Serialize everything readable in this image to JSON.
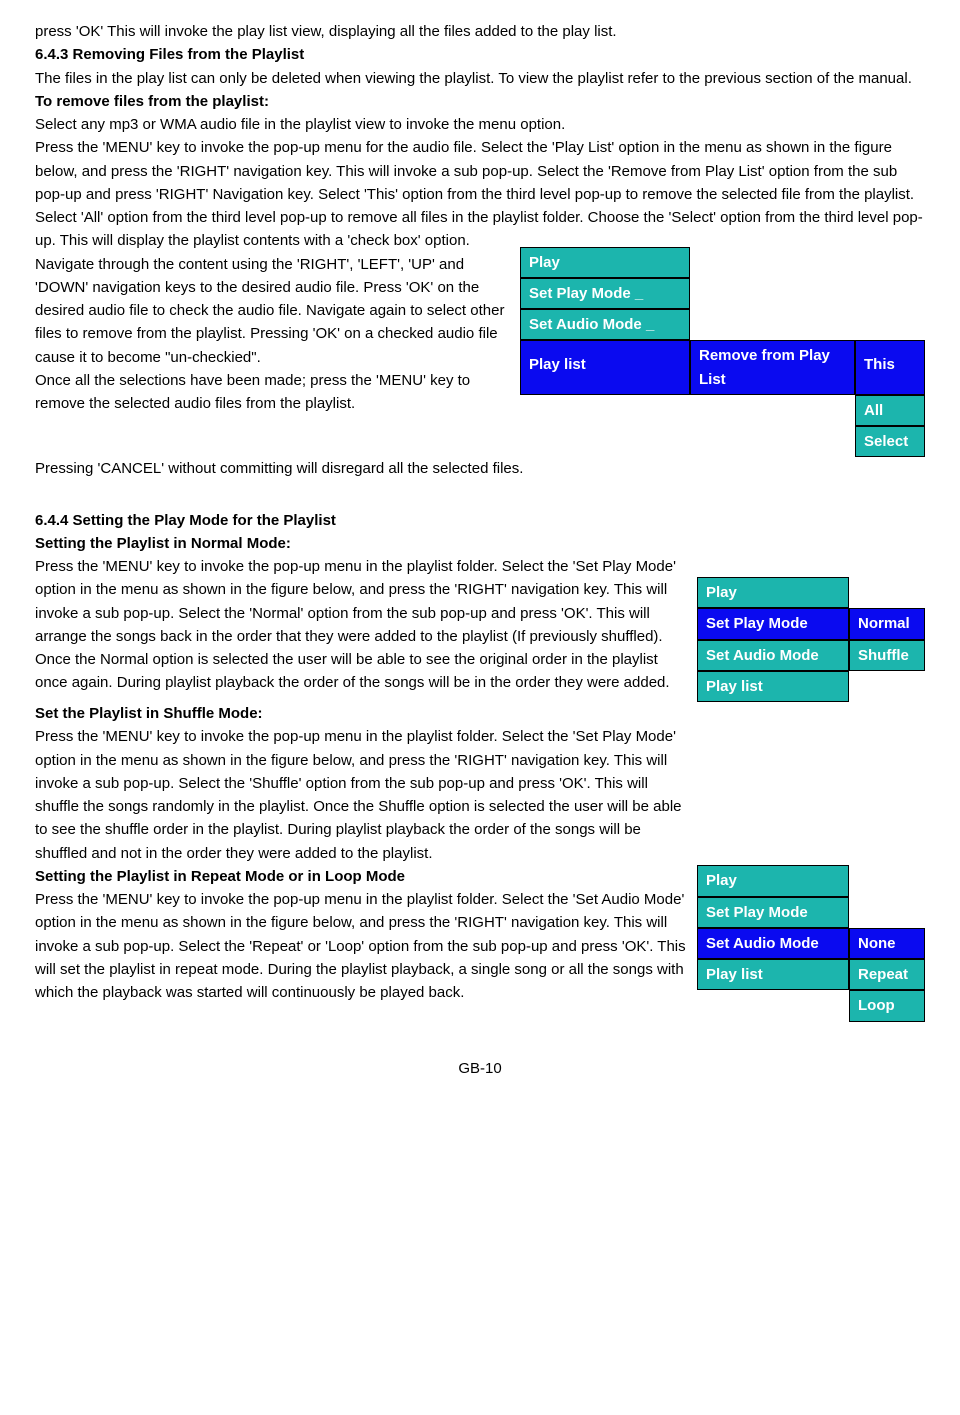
{
  "intro": "press 'OK' This will invoke the play list view, displaying all the files added to the play list.",
  "s643": {
    "heading": "6.4.3 Removing Files from the Playlist",
    "p1": "The files in the play list can only be deleted when viewing the playlist. To view the playlist refer to the previous section of the manual.",
    "sub1": "To remove files from the playlist:",
    "p2": "Select any mp3 or WMA audio file in the playlist view to invoke the  menu option.",
    "p3": "Press the 'MENU' key to  invoke the pop-up menu for the audio file. Select the 'Play List' option  in the menu as shown in the figure below, and press the 'RIGHT' navigation key. This will invoke a sub pop-up. Select the 'Remove from Play List' option from the sub pop-up and press 'RIGHT' Navigation key. Select 'This' option from the third level pop-up to remove the selected file from the playlist. Select 'All' option from the third level pop-up to remove all files in the playlist folder. Choose the 'Select' option from the third level pop-up. This will display the playlist contents with a 'check box' option.",
    "p4": "Navigate through the content using the 'RIGHT', 'LEFT', 'UP' and 'DOWN' navigation keys to the desired audio file. Press 'OK' on the desired audio file to check the audio file. Navigate again to select other files to remove from the playlist. Pressing 'OK' on a checked audio file cause it to become \"un-checkied\".",
    "p5": "Once all the selections have been made; press the 'MENU' key to remove the selected audio files from the playlist.",
    "p6": "Pressing 'CANCEL' without committing will disregard all the selected files."
  },
  "menu1": {
    "c1r1": "Play",
    "c1r2": "Set Play Mode _",
    "c1r3": "Set Audio Mode _",
    "c1r4": "Play list",
    "c2r4": "Remove from Play List",
    "c3r4": "This",
    "c3r5": "All",
    "c3r6": "Select"
  },
  "s644": {
    "heading": "6.4.4 Setting the Play Mode for the Playlist",
    "sub1": "Setting the Playlist in Normal Mode:",
    "p1a": "Press the 'MENU' key to invoke the pop-up menu in the playlist folder. Select the 'Set Play Mode' option in the menu as shown in the figure below, and press the 'RIGHT' navigation key. This will invoke a sub pop-up. Select the 'Normal' option from the sub pop-up and press 'OK'. This will arrange the songs back in the order that they were added to the playlist (If previously shuffled). Once the Normal option is selected the user will be able to see the original order in the playlist once again. During playlist playback the order of the songs will be in the order they were added.",
    "sub2": "Set the Playlist in Shuffle Mode:",
    "p2": "Press the 'MENU' key to invoke the pop-up menu in the playlist folder. Select the 'Set Play Mode' option in the menu as shown in the figure below, and press the 'RIGHT' navigation key. This will invoke a sub pop-up. Select the 'Shuffle' option from the sub pop-up and press 'OK'. This will shuffle the songs randomly in the playlist. Once the Shuffle option is selected the user will be able to see the shuffle order in the playlist. During playlist playback the order of the songs will be shuffled and not in the order they were added to the playlist.",
    "sub3": "Setting the Playlist in Repeat Mode or in Loop Mode",
    "p3": "Press the 'MENU' key to invoke the pop-up menu in the playlist folder. Select the 'Set Audio Mode' option in the menu as shown in the figure below, and press the 'RIGHT' navigation key. This will invoke a sub pop-up. Select the 'Repeat' or 'Loop' option from the sub pop-up and press 'OK'. This will set the playlist in repeat mode. During the playlist playback, a single song or all the songs with which the playback was started will continuously be played back."
  },
  "menu2": {
    "c1r1": "Play",
    "c1r2": "Set Play Mode",
    "c1r3": "Set Audio Mode",
    "c1r4": "Play list",
    "c2r2": "Normal",
    "c2r3": "Shuffle"
  },
  "menu3": {
    "c1r1": "Play",
    "c1r2": "Set Play Mode",
    "c1r3": "Set Audio Mode",
    "c1r4": "Play list",
    "c2r3": "None",
    "c2r4": "Repeat",
    "c2r5": "Loop"
  },
  "pagenum": "GB-10"
}
